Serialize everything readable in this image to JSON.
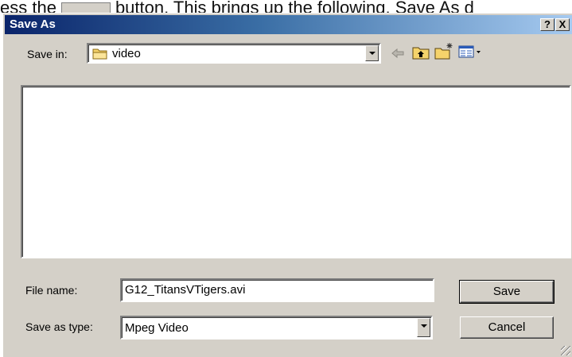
{
  "document": {
    "prefix": "ess the",
    "suffix": "button. This brings up the following, Save As d"
  },
  "dialog": {
    "title": "Save As",
    "help_label": "?",
    "close_label": "X",
    "save_in": {
      "label": "Save in:",
      "value": "video"
    },
    "toolbar_icons": [
      "back-arrow-icon",
      "up-one-level-icon",
      "new-folder-icon",
      "view-menu-icon"
    ],
    "file_name": {
      "label": "File name:",
      "value": "G12_TitansVTigers.avi"
    },
    "save_as_type": {
      "label": "Save as type:",
      "value": "Mpeg Video"
    },
    "buttons": {
      "save": "Save",
      "cancel": "Cancel"
    }
  },
  "colors": {
    "titlebar_start": "#0a246a",
    "titlebar_end": "#a6caf0",
    "dialog_face": "#d4d0c8"
  }
}
